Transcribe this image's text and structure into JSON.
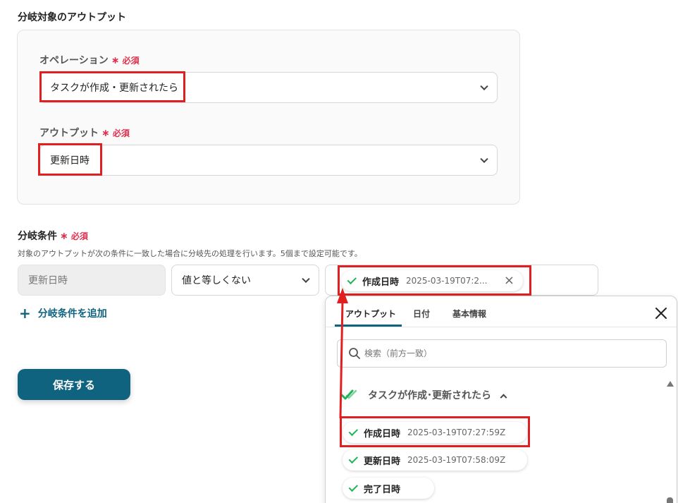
{
  "section1": {
    "title": "分岐対象のアウトプット"
  },
  "required_label": "必須",
  "operation": {
    "label": "オペレーション",
    "value": "タスクが作成・更新されたら"
  },
  "output": {
    "label": "アウトプット",
    "value": "更新日時"
  },
  "condition": {
    "title": "分岐条件",
    "description": "対象のアウトプットが次の条件に一致した場合に分岐先の処理を行います。5個まで設定可能です。",
    "field": "更新日時",
    "operator": "値と等しくない",
    "chip": {
      "name": "作成日時",
      "value": "2025-03-19T07:2..."
    },
    "add_label": "分岐条件を追加"
  },
  "save_label": "保存する",
  "popup": {
    "tabs": [
      "アウトプット",
      "日付",
      "基本情報"
    ],
    "search_placeholder": "検索（前方一致）",
    "group_label": "タスクが作成･更新されたら",
    "items": [
      {
        "name": "作成日時",
        "value": "2025-03-19T07:27:59Z"
      },
      {
        "name": "更新日時",
        "value": "2025-03-19T07:58:09Z"
      },
      {
        "name": "完了日時",
        "value": ""
      }
    ]
  },
  "colors": {
    "primary": "#10637e",
    "required": "#e0304e",
    "highlight": "#e02020",
    "check": "#21b45a"
  }
}
